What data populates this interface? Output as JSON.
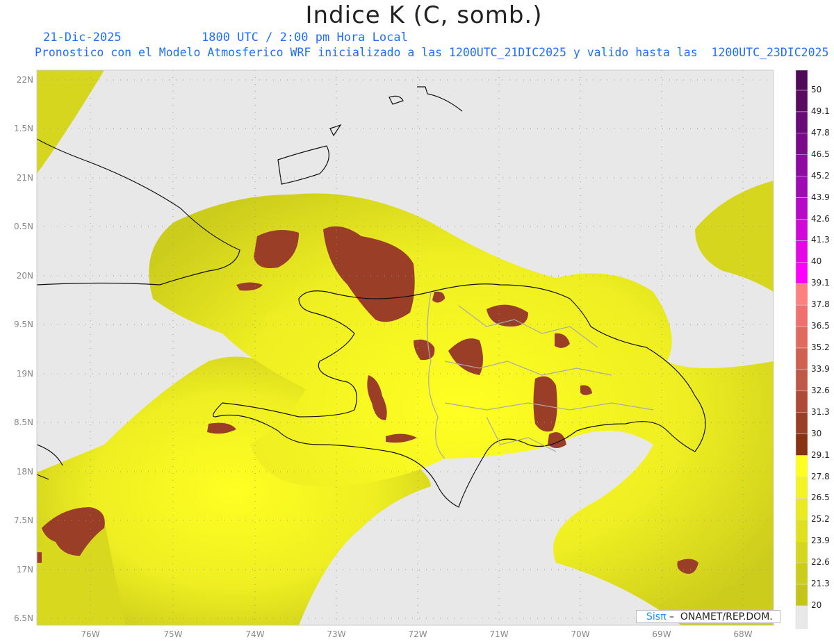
{
  "title": "Indice K (C, somb.)",
  "date": "21-Dic-2025",
  "time": "1800 UTC / 2:00 pm Hora Local",
  "description": "Pronostico con el Modelo Atmosferico WRF inicializado a las 1200UTC_21DIC2025 y valido hasta las  1200UTC_23DIC2025",
  "lon_labels": [
    "76W",
    "75W",
    "74W",
    "73W",
    "72W",
    "71W",
    "70W",
    "69W",
    "68W"
  ],
  "lat_labels": [
    "22N",
    "1.5N",
    "21N",
    "0.5N",
    "20N",
    "9.5N",
    "19N",
    "8.5N",
    "18N",
    "7.5N",
    "17N",
    "6.5N"
  ],
  "colorbar": {
    "labels": [
      "50",
      "49.1",
      "47.8",
      "46.5",
      "45.2",
      "43.9",
      "42.6",
      "41.3",
      "40",
      "39.1",
      "37.8",
      "36.5",
      "35.2",
      "33.9",
      "32.6",
      "31.3",
      "30",
      "29.1",
      "27.8",
      "26.5",
      "25.2",
      "23.9",
      "22.6",
      "21.3",
      "20"
    ],
    "colors": [
      "#5a0a60",
      "#6a0a78",
      "#7a0a8a",
      "#8e0aa0",
      "#a00ab4",
      "#b808c8",
      "#d008d8",
      "#e408e4",
      "#ff00ff",
      "#ff8080",
      "#f07070",
      "#e06a60",
      "#d06050",
      "#c05848",
      "#ad4a38",
      "#9a3e28",
      "#8a3214",
      "#ffff20",
      "#f4f424",
      "#eaea22",
      "#e0e020",
      "#d6d61e",
      "#cccc1c",
      "#c4c41a",
      "#e8e8e8"
    ]
  },
  "credit": {
    "brand": "Sisπ",
    "text": " –  ONAMET/REP.DOM."
  }
}
